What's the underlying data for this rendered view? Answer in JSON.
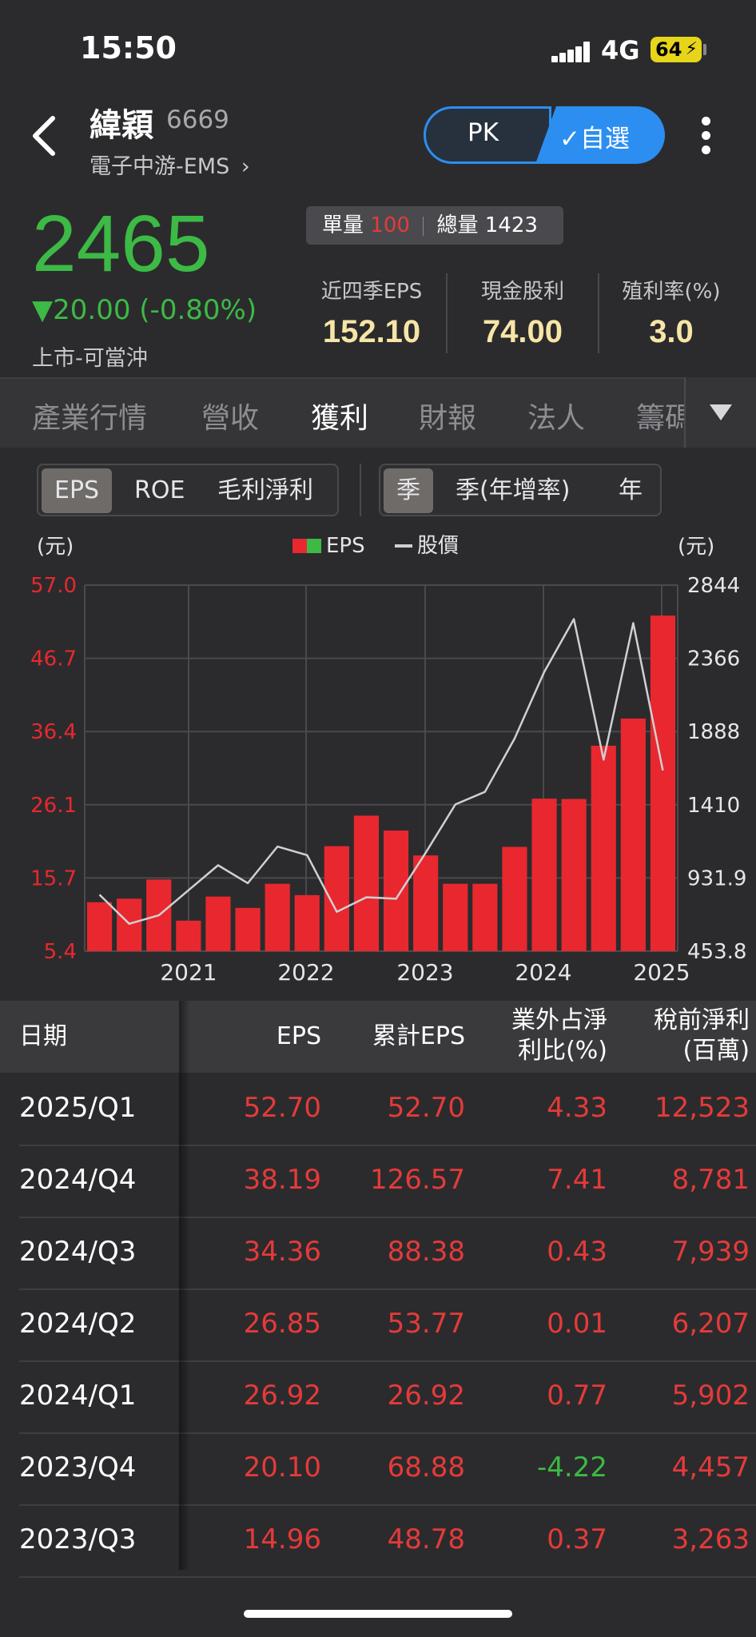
{
  "status_bar": {
    "time": "15:50",
    "network": "4G",
    "battery": "64"
  },
  "header": {
    "back_icon": "chevron-left-icon",
    "stock_name": "緯穎",
    "stock_code": "6669",
    "sector": "電子中游-EMS",
    "pk_label": "PK",
    "watchlist_label": "✓自選",
    "accent": "#2c8ef0"
  },
  "quote": {
    "price": "2465",
    "change": "▼20.00 (-0.80%)",
    "market": "上市-可當沖",
    "volume_label": "單量",
    "volume_value": "100",
    "total_label": "總量",
    "total_value": "1423",
    "kpis": [
      {
        "label": "近四季EPS",
        "value": "152.10"
      },
      {
        "label": "現金股利",
        "value": "74.00"
      },
      {
        "label": "殖利率(%)",
        "value": "3.0"
      }
    ]
  },
  "tabs": [
    "產業行情",
    "營收",
    "獲利",
    "財報",
    "法人",
    "籌碼"
  ],
  "active_tab": "獲利",
  "metric_toggle": [
    "EPS",
    "ROE",
    "毛利淨利"
  ],
  "period_toggle": [
    "季",
    "季(年增率)",
    "年"
  ],
  "chart_data": {
    "type": "bar",
    "left_unit": "(元)",
    "right_unit": "(元)",
    "legend": [
      "EPS",
      "股價"
    ],
    "left_ticks": [
      "57.0",
      "46.7",
      "36.4",
      "26.1",
      "15.7",
      "5.4"
    ],
    "right_ticks": [
      "2844",
      "2366",
      "1888",
      "1410",
      "931.9",
      "453.8"
    ],
    "x_labels": [
      "2021",
      "2022",
      "2023",
      "2024",
      "2025"
    ],
    "ylim": [
      5.4,
      57.0
    ],
    "y2lim": [
      453.8,
      2844
    ],
    "series": [
      {
        "name": "EPS",
        "values": [
          12.3,
          12.8,
          15.5,
          9.7,
          13.1,
          11.5,
          14.9,
          13.3,
          20.2,
          24.5,
          22.4,
          18.9,
          14.9,
          14.9,
          20.1,
          26.9,
          26.85,
          34.36,
          38.19,
          52.7
        ]
      },
      {
        "name": "股價",
        "values": [
          823,
          633,
          688,
          852,
          1015,
          898,
          1137,
          1081,
          711,
          806,
          796,
          1096,
          1412,
          1494,
          1842,
          2277,
          2622,
          1704,
          2596,
          1634
        ]
      }
    ],
    "colors": {
      "up": "#e8282e",
      "down": "#3cba45",
      "line": "#d0d0d4"
    }
  },
  "table": {
    "headers": [
      "日期",
      "EPS",
      "累計EPS",
      "業外占淨\n利比(%)",
      "稅前淨利\n(百萬)"
    ],
    "rows": [
      [
        "2025/Q1",
        "52.70",
        "52.70",
        "4.33",
        "12,523"
      ],
      [
        "2024/Q4",
        "38.19",
        "126.57",
        "7.41",
        "8,781"
      ],
      [
        "2024/Q3",
        "34.36",
        "88.38",
        "0.43",
        "7,939"
      ],
      [
        "2024/Q2",
        "26.85",
        "53.77",
        "0.01",
        "6,207"
      ],
      [
        "2024/Q1",
        "26.92",
        "26.92",
        "0.77",
        "5,902"
      ],
      [
        "2023/Q4",
        "20.10",
        "68.88",
        "-4.22",
        "4,457"
      ],
      [
        "2023/Q3",
        "14.96",
        "48.78",
        "0.37",
        "3,263"
      ]
    ]
  }
}
